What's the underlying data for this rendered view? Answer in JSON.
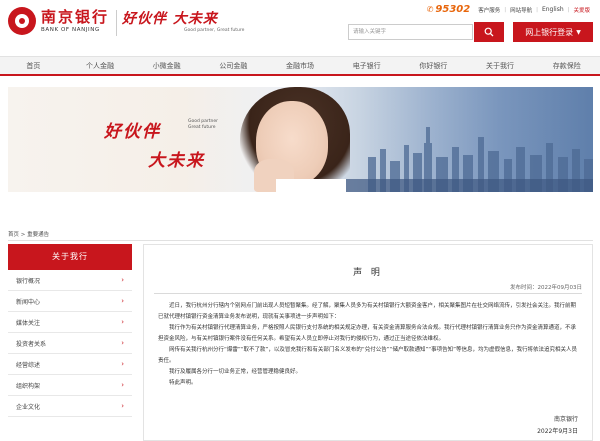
{
  "header": {
    "logo_cn": "南京银行",
    "logo_en": "BANK OF NANJING",
    "slogan_cn": "好伙伴 大未来",
    "slogan_en": "Good partner, Great future",
    "hotline": "95302",
    "links": [
      "客户服务",
      "网站导航",
      "English",
      "关爱版"
    ],
    "search_placeholder": "请输入关键字",
    "ebank_label": "网上银行登录"
  },
  "nav": [
    "首页",
    "个人金融",
    "小微金融",
    "公司金融",
    "金融市场",
    "电子银行",
    "你好银行",
    "关于我行",
    "存款保险"
  ],
  "banner": {
    "cn1": "好伙伴",
    "en": "Good partner Great future",
    "cn2": "大未来"
  },
  "breadcrumb": "首页 > 重要通告",
  "sidebar": {
    "title": "关于我行",
    "items": [
      "银行概况",
      "新闻中心",
      "媒体关注",
      "投资者关系",
      "经营综述",
      "组织构架",
      "企业文化"
    ]
  },
  "article": {
    "title": "声 明",
    "date": "发布时间：2022年09月03日",
    "paragraphs": [
      "近日，我行杭州分行辖内个别网点门前出现人员短暂聚集。经了解，聚集人员多为有关村镇银行大额资金客户，相关聚集图片在社交网络流传，引发社会关注。我行前期已就代理村镇银行资金清算业务发布说明，现就有关事项进一步声明如下：",
      "我行作为有关村镇银行代理清算业务，严格按照人民银行支付系统的相关规定办理，有关资金清算服务合法合规。我行代理村镇银行清算业务只作为资金清算通道，不承担资金风险，与有关村镇银行案件没有任何关系。希望有关人员立即停止对我行的侵权行为，通过正当途径依法维权。",
      "网传有关我行杭州分行“爆雷”“取不了款”，以及冒充我行和有关部门名义发布的“兑付公告”“储户取款通知”“事项告知”等信息，均为虚假信息，我行将依法追究相关人员责任。",
      "我行及履属各分行一切业务正常，经营管理稳健良好。",
      "特此声明。"
    ],
    "signature": "南京银行",
    "sign_date": "2022年9月3日"
  },
  "colors": {
    "brand": "#c8161d",
    "hotline": "#e8660c"
  }
}
